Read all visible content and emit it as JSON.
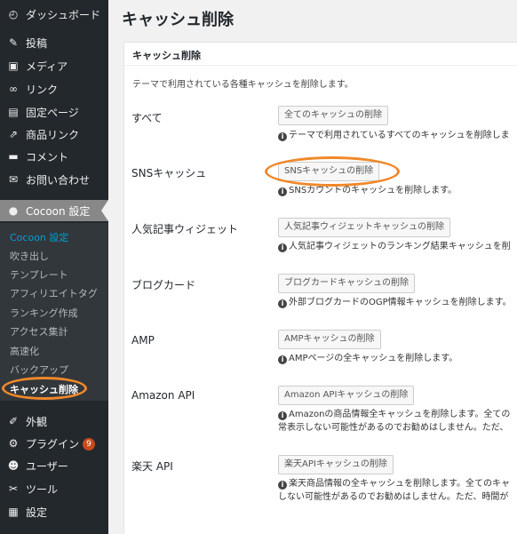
{
  "sidebar": {
    "items": [
      {
        "label": "ダッシュボード",
        "icon": "dashboard-icon",
        "glyph": "◴"
      },
      {
        "label": "投稿",
        "icon": "pin-icon",
        "glyph": "✎"
      },
      {
        "label": "メディア",
        "icon": "media-icon",
        "glyph": "▣"
      },
      {
        "label": "リンク",
        "icon": "link-icon",
        "glyph": "∞"
      },
      {
        "label": "固定ページ",
        "icon": "page-icon",
        "glyph": "▤"
      },
      {
        "label": "商品リンク",
        "icon": "share-icon",
        "glyph": "⇗"
      },
      {
        "label": "コメント",
        "icon": "comment-icon",
        "glyph": "▬"
      },
      {
        "label": "お問い合わせ",
        "icon": "mail-icon",
        "glyph": "✉"
      }
    ],
    "active": {
      "label": "Cocoon 設定",
      "icon": "cocoon-icon",
      "glyph": "●"
    },
    "submenu": [
      "Cocoon 設定",
      "吹き出し",
      "テンプレート",
      "アフィリエイトタグ",
      "ランキング作成",
      "アクセス集計",
      "高速化",
      "バックアップ",
      "キャッシュ削除"
    ],
    "bottom_items": [
      {
        "label": "外観",
        "icon": "appearance-icon",
        "glyph": "✐"
      },
      {
        "label": "プラグイン",
        "icon": "plugin-icon",
        "glyph": "⚙",
        "badge": "9"
      },
      {
        "label": "ユーザー",
        "icon": "user-icon",
        "glyph": "☻"
      },
      {
        "label": "ツール",
        "icon": "tool-icon",
        "glyph": "✂"
      },
      {
        "label": "設定",
        "icon": "settings-icon",
        "glyph": "▦"
      }
    ]
  },
  "page": {
    "title": "キャッシュ削除",
    "panel_title": "キャッシュ削除",
    "intro": "テーマで利用されている各種キャッシュを削除します。"
  },
  "rows": [
    {
      "label": "すべて",
      "button": "全てのキャッシュの削除",
      "desc": [
        "テーマで利用されているすべてのキャッシュを削除しま"
      ]
    },
    {
      "label": "SNSキャッシュ",
      "button": "SNSキャッシュの削除",
      "desc": [
        "SNSカウントのキャッシュを削除します。"
      ]
    },
    {
      "label": "人気記事ウィジェット",
      "button": "人気記事ウィジェットキャッシュの削除",
      "desc": [
        "人気記事ウィジェットのランキング結果キャッシュを削"
      ]
    },
    {
      "label": "ブログカード",
      "button": "ブログカードキャッシュの削除",
      "desc": [
        "外部ブログカードのOGP情報キャッシュを削除します。"
      ]
    },
    {
      "label": "AMP",
      "button": "AMPキャッシュの削除",
      "desc": [
        "AMPページの全キャッシュを削除します。"
      ]
    },
    {
      "label": "Amazon API",
      "button": "Amazon APIキャッシュの削除",
      "desc": [
        "Amazonの商品情報全キャッシュを削除します。全ての",
        "常表示しない可能性があるのでお勧めはしません。ただ、"
      ]
    },
    {
      "label": "楽天 API",
      "button": "楽天APIキャッシュの削除",
      "desc": [
        "楽天商品情報の全キャッシュを削除します。全てのキャ",
        "しない可能性があるのでお勧めはしません。ただ、時間が"
      ]
    }
  ],
  "colors": {
    "highlight": "#f0882a",
    "sidebar_bg": "#23282d",
    "active_bg": "#888888"
  }
}
